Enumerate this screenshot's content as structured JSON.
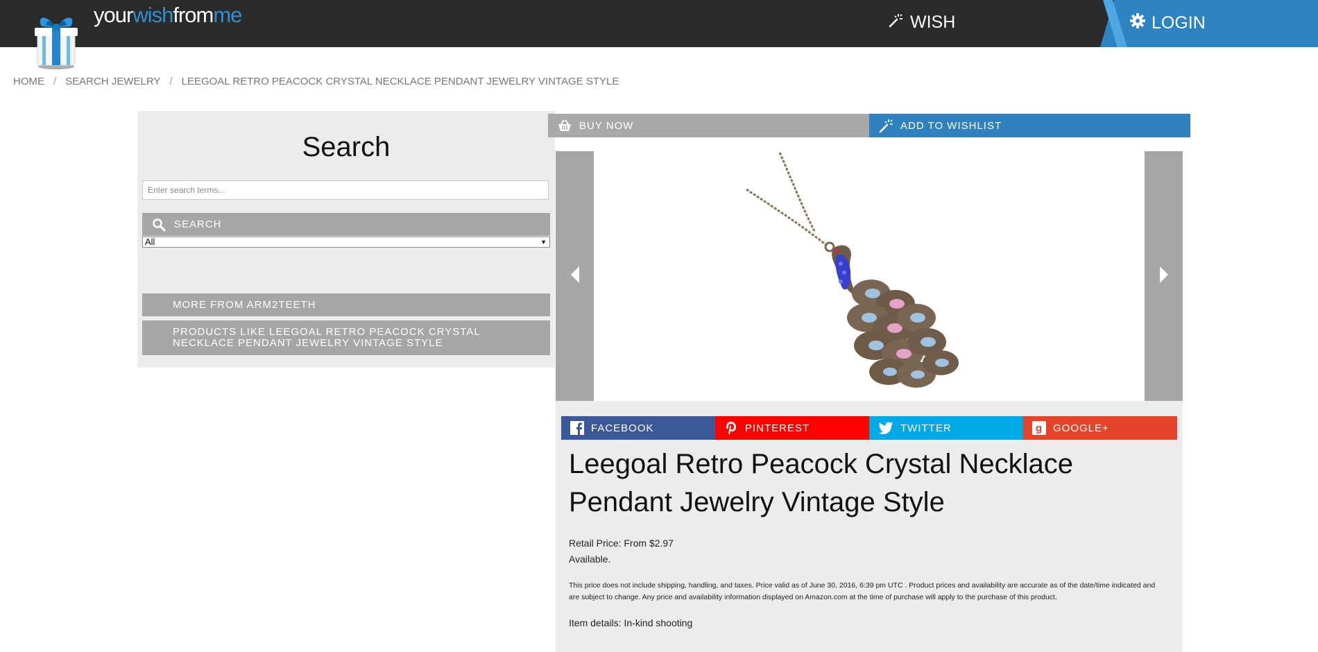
{
  "header": {
    "logo": {
      "part1": "your",
      "part2": "wish",
      "part3": "from",
      "part4": "me"
    },
    "wish_label": "WISH",
    "login_label": "LOGIN"
  },
  "breadcrumb": {
    "items": [
      "HOME",
      "SEARCH JEWELRY",
      "LEEGOAL RETRO PEACOCK CRYSTAL NECKLACE PENDANT JEWELRY VINTAGE STYLE"
    ],
    "separator": "/"
  },
  "search": {
    "title": "Search",
    "placeholder": "Enter search terms...",
    "button_label": "SEARCH",
    "category_selected": "All"
  },
  "sidebar": {
    "more_from": "MORE FROM ARM2TEETH",
    "products_like": "PRODUCTS LIKE LEEGOAL RETRO PEACOCK CRYSTAL NECKLACE PENDANT JEWELRY VINTAGE STYLE"
  },
  "actions": {
    "buy_now": "BUY NOW",
    "add_to_wishlist": "ADD TO WISHLIST"
  },
  "share": {
    "facebook": "FACEBOOK",
    "pinterest": "PINTEREST",
    "twitter": "TWITTER",
    "googleplus": "GOOGLE+"
  },
  "product": {
    "title": "Leegoal Retro Peacock Crystal Necklace Pendant Jewelry Vintage Style",
    "retail_price": "Retail Price: From $2.97",
    "availability": "Available.",
    "disclaimer": "This price does not include shipping, handling, and taxes. Price valid as of June 30, 2016, 6:39 pm UTC . Product prices and availability are accurate as of the date/time indicated and are subject to change. Any price and availability information displayed on Amazon.com at the time of purchase will apply to the purchase of this product.",
    "details_label": "Item details:",
    "details_value": "In-kind shooting"
  },
  "colors": {
    "header_bg": "#2a2a2a",
    "brand_blue": "#2f82be",
    "panel_bg": "#ececec",
    "button_gray": "#a6a6a6",
    "facebook": "#3b5998",
    "pinterest": "#ff0000",
    "twitter": "#00a9e6",
    "googleplus": "#e4442a"
  }
}
